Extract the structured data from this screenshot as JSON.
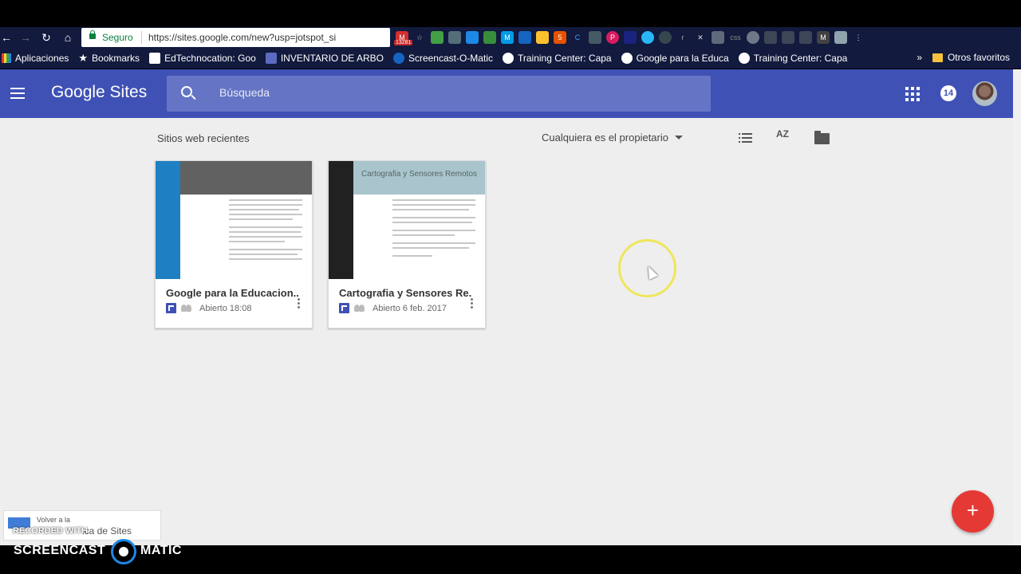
{
  "browser": {
    "secure_label": "Seguro",
    "url": "https://sites.google.com/new?usp=jotspot_si",
    "mail_badge": "13281",
    "bookmarks": [
      {
        "label": "Aplicaciones",
        "icon": "apps-grid-icon"
      },
      {
        "label": "Bookmarks",
        "icon": "star-icon"
      },
      {
        "label": "EdTechnocation: Goo",
        "icon": "edtech-icon"
      },
      {
        "label": "INVENTARIO DE ARBO",
        "icon": "sheet-icon"
      },
      {
        "label": "Screencast-O-Matic",
        "icon": "screencast-icon"
      },
      {
        "label": "Training Center: Capa",
        "icon": "google-icon"
      },
      {
        "label": "Google para la Educa",
        "icon": "google-icon"
      },
      {
        "label": "Training Center: Capa",
        "icon": "google-icon"
      }
    ],
    "more_bookmarks": "»",
    "other_favorites": "Otros favoritos"
  },
  "app": {
    "logo": "Google Sites",
    "search_placeholder": "Búsqueda",
    "notification_count": "14",
    "brand_color": "#3f51b5"
  },
  "main": {
    "section_title": "Sitios web recientes",
    "owner_filter": "Cualquiera es el propietario",
    "sort_label": "AZ",
    "sites": [
      {
        "title": "Google para la Educacion...",
        "opened": "Abierto 18:08"
      },
      {
        "title": "Cartografia y Sensores Re...",
        "opened": "Abierto 6 feb. 2017",
        "thumb_heading": "Cartografia y Sensores Remotos"
      }
    ],
    "fab_label": "+",
    "back_snack_top": "Volver a la",
    "back_snack_main": "ica de Sites"
  },
  "watermark": {
    "recorded_with": "RECORDED WITH",
    "left": "SCREENCAST",
    "right": "MATIC"
  }
}
